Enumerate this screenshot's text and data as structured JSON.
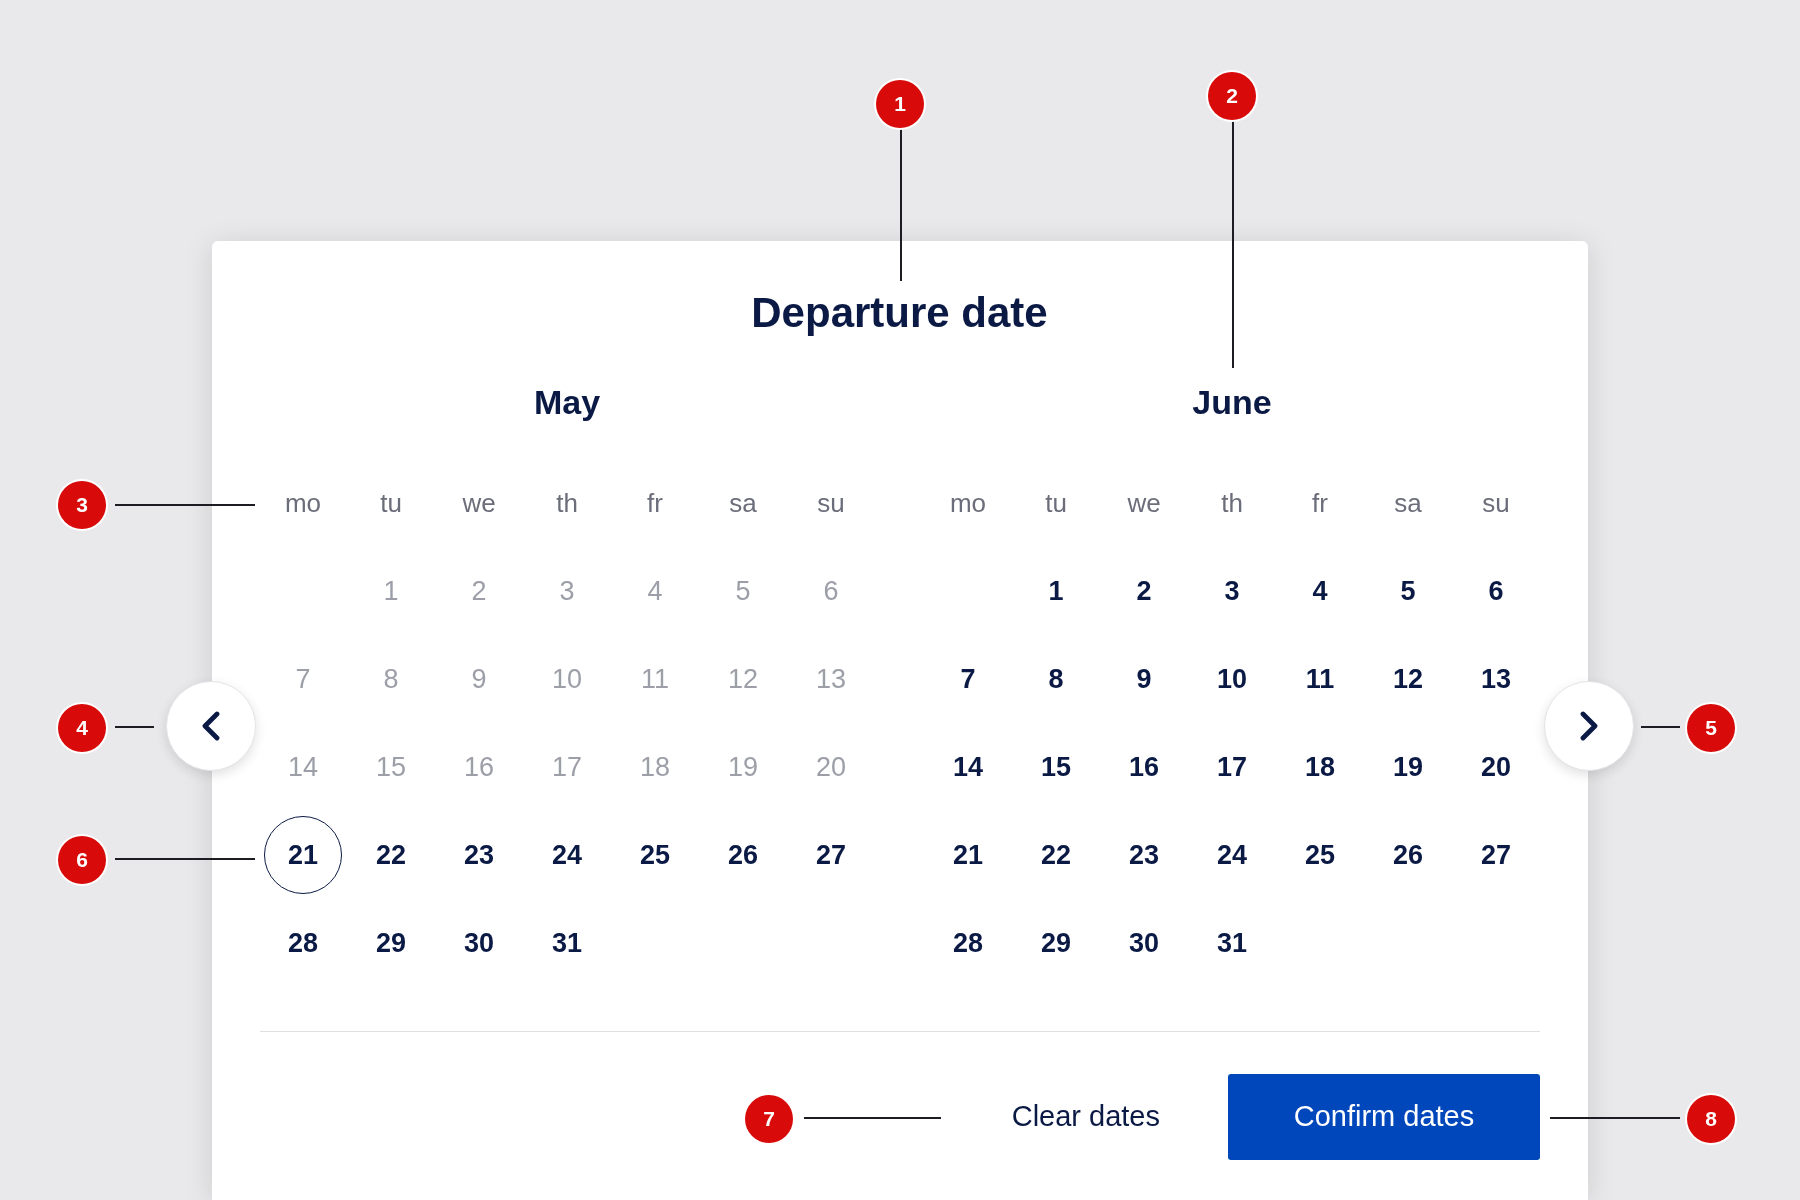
{
  "dialog": {
    "title": "Departure date",
    "months": [
      {
        "name": "May",
        "weekdays": [
          "mo",
          "tu",
          "we",
          "th",
          "fr",
          "sa",
          "su"
        ],
        "weeks": [
          {
            "days": [
              {
                "label": "1",
                "disabled": true,
                "selected": false
              },
              {
                "label": "2",
                "disabled": true,
                "selected": false
              },
              {
                "label": "3",
                "disabled": true,
                "selected": false
              },
              {
                "label": "4",
                "disabled": true,
                "selected": false
              },
              {
                "label": "5",
                "disabled": true,
                "selected": false
              },
              {
                "label": "6",
                "disabled": true,
                "selected": false
              }
            ]
          },
          {
            "days": [
              {
                "label": "7",
                "disabled": true,
                "selected": false
              },
              {
                "label": "8",
                "disabled": true,
                "selected": false
              },
              {
                "label": "9",
                "disabled": true,
                "selected": false
              },
              {
                "label": "10",
                "disabled": true,
                "selected": false
              },
              {
                "label": "11",
                "disabled": true,
                "selected": false
              },
              {
                "label": "12",
                "disabled": true,
                "selected": false
              },
              {
                "label": "13",
                "disabled": true,
                "selected": false
              }
            ]
          },
          {
            "days": [
              {
                "label": "14",
                "disabled": true,
                "selected": false
              },
              {
                "label": "15",
                "disabled": true,
                "selected": false
              },
              {
                "label": "16",
                "disabled": true,
                "selected": false
              },
              {
                "label": "17",
                "disabled": true,
                "selected": false
              },
              {
                "label": "18",
                "disabled": true,
                "selected": false
              },
              {
                "label": "19",
                "disabled": true,
                "selected": false
              },
              {
                "label": "20",
                "disabled": true,
                "selected": false
              }
            ]
          },
          {
            "days": [
              {
                "label": "21",
                "disabled": false,
                "selected": true
              },
              {
                "label": "22",
                "disabled": false,
                "selected": false
              },
              {
                "label": "23",
                "disabled": false,
                "selected": false
              },
              {
                "label": "24",
                "disabled": false,
                "selected": false
              },
              {
                "label": "25",
                "disabled": false,
                "selected": false
              },
              {
                "label": "26",
                "disabled": false,
                "selected": false
              },
              {
                "label": "27",
                "disabled": false,
                "selected": false
              }
            ]
          },
          {
            "days": [
              {
                "label": "28",
                "disabled": false,
                "selected": false
              },
              {
                "label": "29",
                "disabled": false,
                "selected": false
              },
              {
                "label": "30",
                "disabled": false,
                "selected": false
              },
              {
                "label": "31",
                "disabled": false,
                "selected": false
              }
            ]
          }
        ]
      },
      {
        "name": "June",
        "weekdays": [
          "mo",
          "tu",
          "we",
          "th",
          "fr",
          "sa",
          "su"
        ],
        "weeks": [
          {
            "days": [
              {
                "label": "1",
                "disabled": false,
                "selected": false
              },
              {
                "label": "2",
                "disabled": false,
                "selected": false
              },
              {
                "label": "3",
                "disabled": false,
                "selected": false
              },
              {
                "label": "4",
                "disabled": false,
                "selected": false
              },
              {
                "label": "5",
                "disabled": false,
                "selected": false
              },
              {
                "label": "6",
                "disabled": false,
                "selected": false
              }
            ]
          },
          {
            "days": [
              {
                "label": "7",
                "disabled": false,
                "selected": false
              },
              {
                "label": "8",
                "disabled": false,
                "selected": false
              },
              {
                "label": "9",
                "disabled": false,
                "selected": false
              },
              {
                "label": "10",
                "disabled": false,
                "selected": false
              },
              {
                "label": "11",
                "disabled": false,
                "selected": false
              },
              {
                "label": "12",
                "disabled": false,
                "selected": false
              },
              {
                "label": "13",
                "disabled": false,
                "selected": false
              }
            ]
          },
          {
            "days": [
              {
                "label": "14",
                "disabled": false,
                "selected": false
              },
              {
                "label": "15",
                "disabled": false,
                "selected": false
              },
              {
                "label": "16",
                "disabled": false,
                "selected": false
              },
              {
                "label": "17",
                "disabled": false,
                "selected": false
              },
              {
                "label": "18",
                "disabled": false,
                "selected": false
              },
              {
                "label": "19",
                "disabled": false,
                "selected": false
              },
              {
                "label": "20",
                "disabled": false,
                "selected": false
              }
            ]
          },
          {
            "days": [
              {
                "label": "21",
                "disabled": false,
                "selected": false
              },
              {
                "label": "22",
                "disabled": false,
                "selected": false
              },
              {
                "label": "23",
                "disabled": false,
                "selected": false
              },
              {
                "label": "24",
                "disabled": false,
                "selected": false
              },
              {
                "label": "25",
                "disabled": false,
                "selected": false
              },
              {
                "label": "26",
                "disabled": false,
                "selected": false
              },
              {
                "label": "27",
                "disabled": false,
                "selected": false
              }
            ]
          },
          {
            "days": [
              {
                "label": "28",
                "disabled": false,
                "selected": false
              },
              {
                "label": "29",
                "disabled": false,
                "selected": false
              },
              {
                "label": "30",
                "disabled": false,
                "selected": false
              },
              {
                "label": "31",
                "disabled": false,
                "selected": false
              }
            ]
          }
        ]
      }
    ],
    "buttons": [
      {
        "label": "Clear dates",
        "kind": "link"
      },
      {
        "label": "Confirm dates",
        "kind": "primary"
      }
    ]
  },
  "annotations": [
    {
      "label": "1"
    },
    {
      "label": "2"
    },
    {
      "label": "3"
    },
    {
      "label": "4"
    },
    {
      "label": "5"
    },
    {
      "label": "6"
    },
    {
      "label": "7"
    },
    {
      "label": "8"
    }
  ]
}
